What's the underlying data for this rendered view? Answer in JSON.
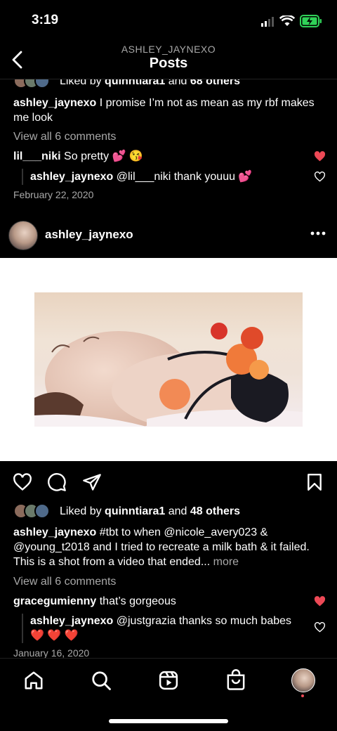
{
  "status_bar": {
    "time": "3:19"
  },
  "header": {
    "username": "ASHLEY_JAYNEXO",
    "title": "Posts"
  },
  "post1": {
    "liked_prefix": "Liked by",
    "liked_user": "quinntiara1",
    "liked_and": "and",
    "liked_count": "68 others",
    "caption_user": "ashley_jaynexo",
    "caption_text": "I promise I’m not as mean as my rbf makes me look",
    "view_comments": "View all 6 comments",
    "comment1_user": "lil___niki",
    "comment1_text": "So pretty 💕 😘",
    "reply1_user": "ashley_jaynexo",
    "reply1_text": "@lil___niki thank youuu 💕",
    "date": "February 22, 2020"
  },
  "post2": {
    "username": "ashley_jaynexo",
    "liked_prefix": "Liked by",
    "liked_user": "quinntiara1",
    "liked_and": "and",
    "liked_count": "48 others",
    "caption_user": "ashley_jaynexo",
    "caption_text": "#tbt to when @nicole_avery023 & @young_t2018 and I tried to recreate a milk bath & it failed. This is a shot from a video that ended...",
    "caption_more": "more",
    "view_comments": "View all 6 comments",
    "comment1_user": "gracegumienny",
    "comment1_text": "that’s gorgeous",
    "reply1_user": "ashley_jaynexo",
    "reply1_text": "@justgrazia thanks so much babes ❤️ ❤️ ❤️",
    "date": "January 16, 2020"
  },
  "tabbar": {
    "items": [
      "home-icon",
      "search-icon",
      "reels-icon",
      "shop-icon",
      "profile-avatar"
    ]
  },
  "colors": {
    "like_red": "#ed4956",
    "muted": "#a8a8a8",
    "background": "#000000"
  }
}
